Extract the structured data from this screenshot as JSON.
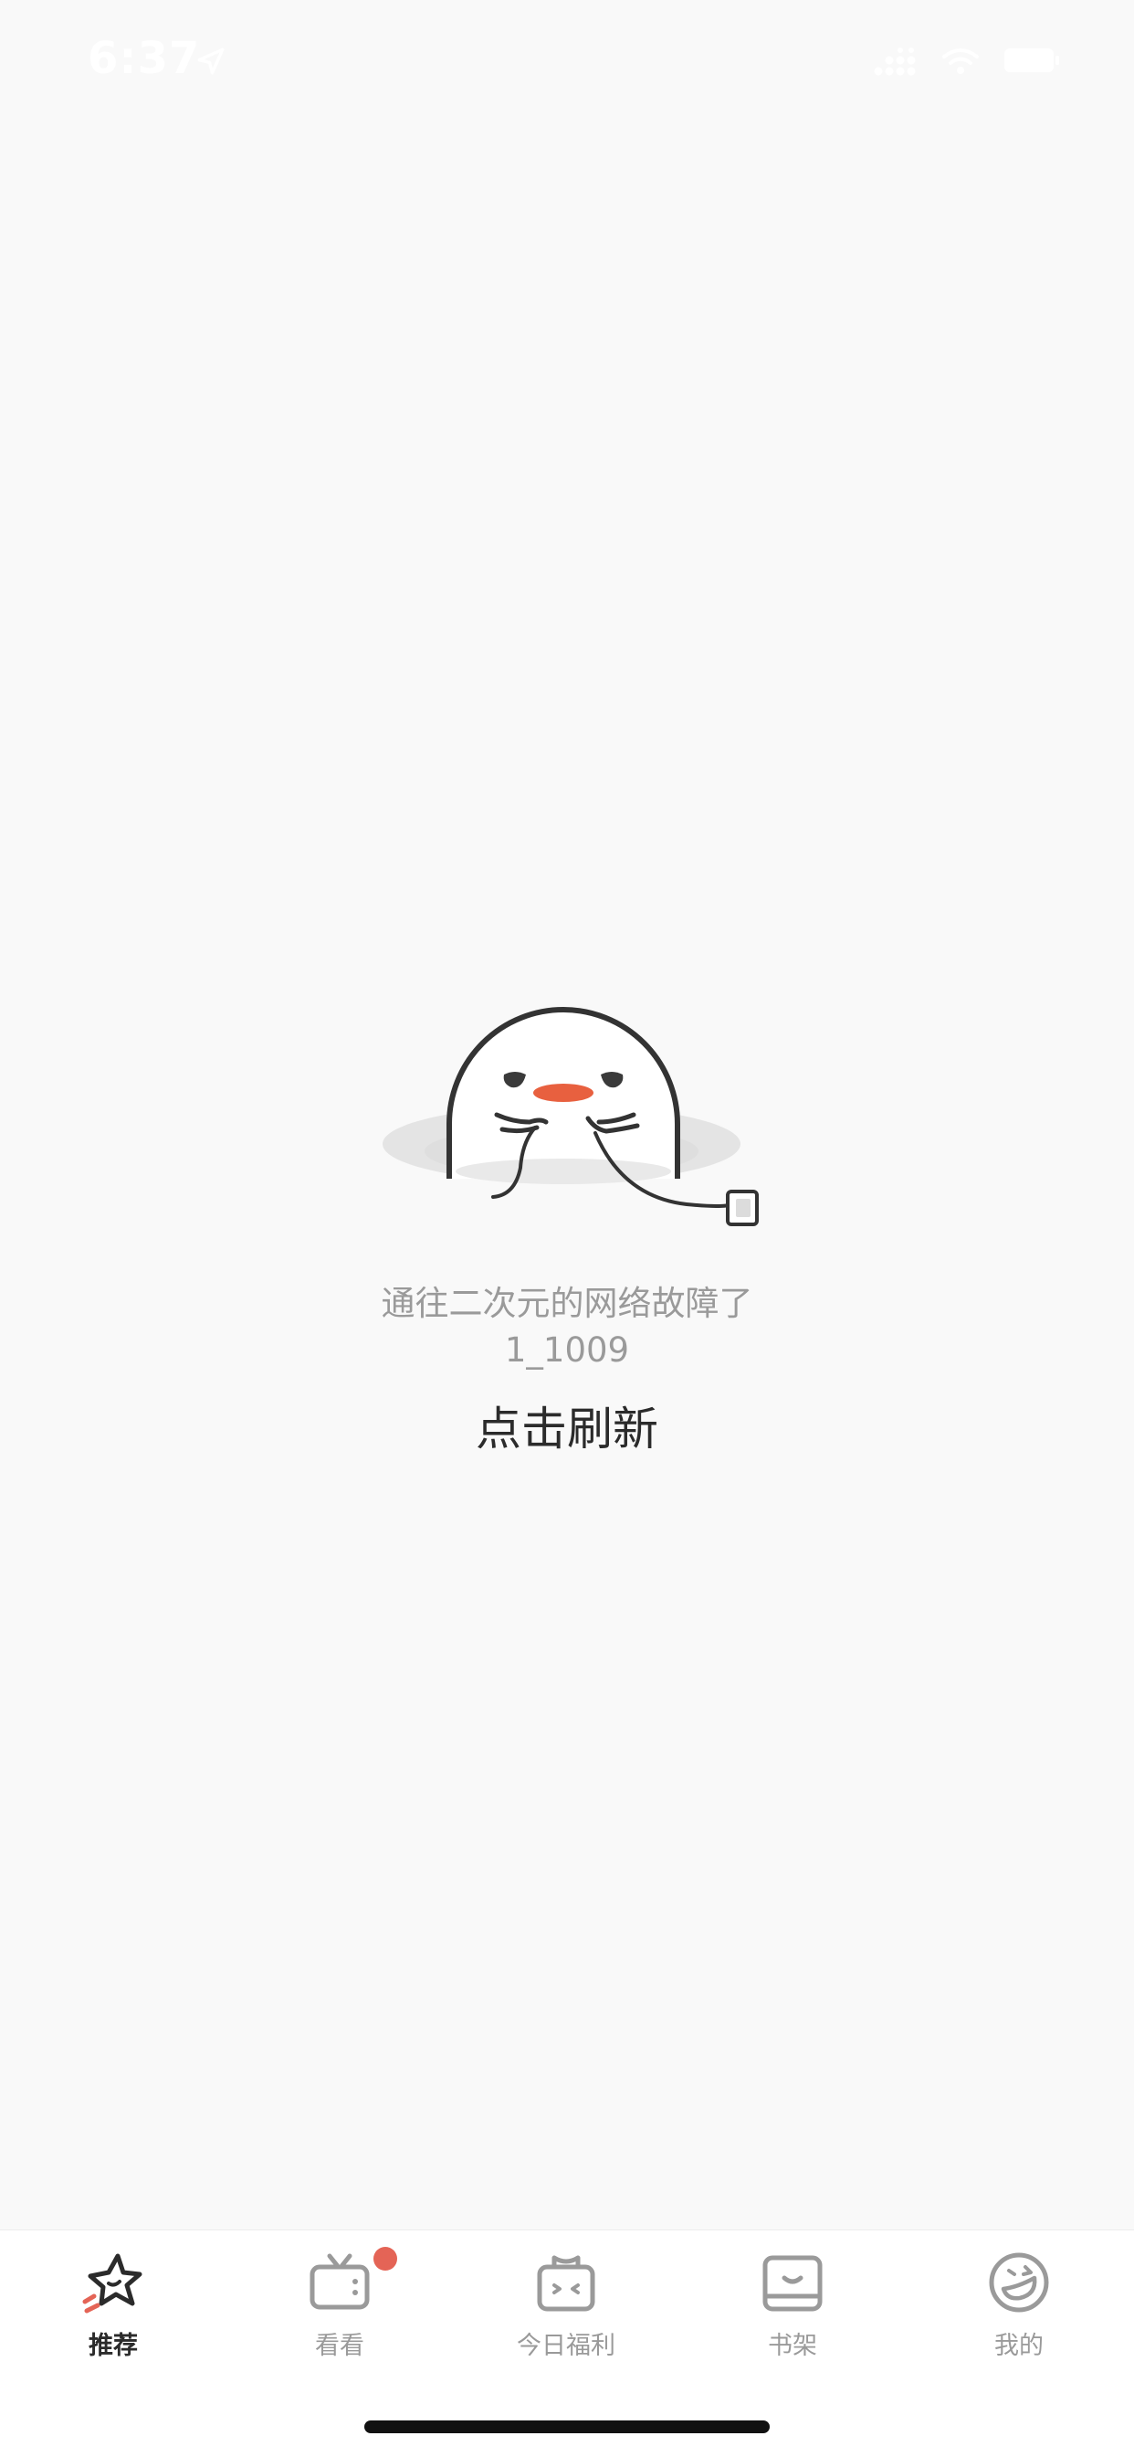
{
  "status_bar": {
    "time": "6:37",
    "icons": [
      "location-arrow-icon",
      "signal-icon",
      "wifi-icon",
      "battery-icon"
    ]
  },
  "error": {
    "illustration": "sad-mascot-unplugged-illustration",
    "message": "通往二次元的网络故障了",
    "code": "1_1009",
    "refresh_label": "点击刷新"
  },
  "tab_bar": {
    "items": [
      {
        "label": "推荐",
        "icon": "star-icon",
        "active": true
      },
      {
        "label": "看看",
        "icon": "tv-icon",
        "active": false,
        "badge": true
      },
      {
        "label": "今日福利",
        "icon": "gift-icon",
        "active": false
      },
      {
        "label": "书架",
        "icon": "bookshelf-icon",
        "active": false
      },
      {
        "label": "我的",
        "icon": "smiley-face-icon",
        "active": false
      }
    ]
  },
  "colors": {
    "background": "#f9f9f9",
    "accent": "#e46456",
    "text_primary": "#2b2b2b",
    "text_secondary": "#9a9a9a"
  }
}
